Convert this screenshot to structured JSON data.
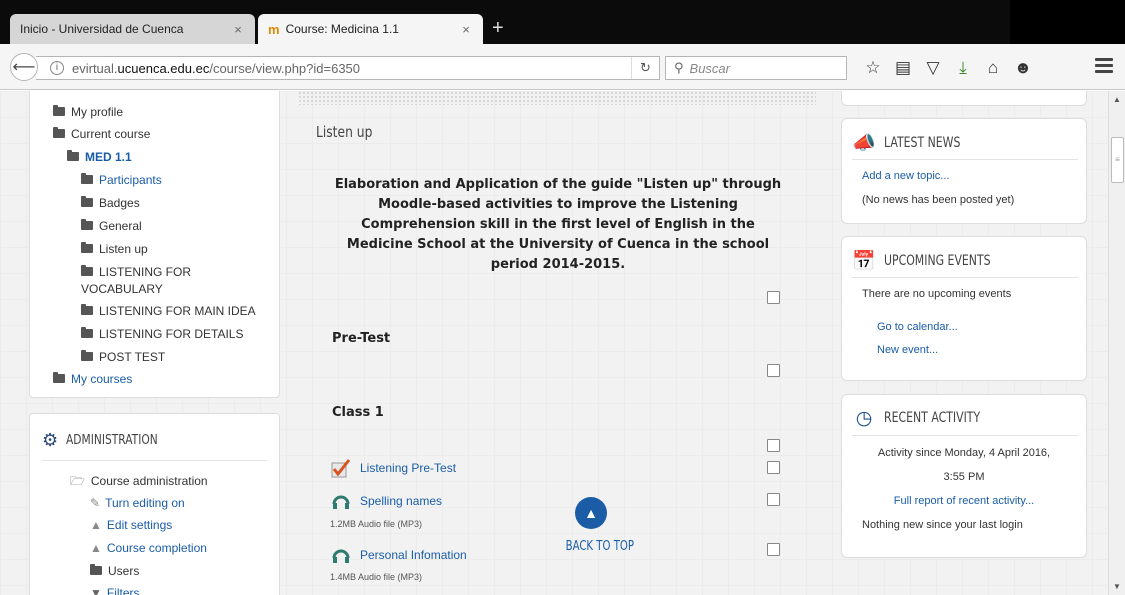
{
  "browser": {
    "tabs": [
      {
        "title": "Inicio - Universidad de Cuenca",
        "close": "×"
      },
      {
        "title": "Course: Medicina 1.1",
        "close": "×",
        "favicon": "m"
      }
    ],
    "new_tab": "+",
    "url_prefix": "evirtual.",
    "url_host": "ucuenca.edu.ec",
    "url_path": "/course/view.php?id=6350",
    "search_placeholder": "Buscar",
    "icons": [
      "star-icon",
      "reading-list-icon",
      "pocket-icon",
      "download-icon",
      "home-icon",
      "chat-icon",
      "menu-icon"
    ]
  },
  "navigation": {
    "items": [
      {
        "label": "My profile",
        "kind": "folder"
      },
      {
        "label": "Current course",
        "kind": "folder"
      },
      {
        "label": "MED 1.1",
        "kind": "folder-bold"
      },
      {
        "label": "Participants",
        "kind": "folder-link"
      },
      {
        "label": "Badges",
        "kind": "folder"
      },
      {
        "label": "General",
        "kind": "folder"
      },
      {
        "label": "Listen up",
        "kind": "folder"
      },
      {
        "label": "LISTENING FOR",
        "kind": "folder"
      },
      {
        "label": "VOCABULARY",
        "kind": "text"
      },
      {
        "label": "LISTENING FOR MAIN IDEA",
        "kind": "folder"
      },
      {
        "label": "LISTENING FOR DETAILS",
        "kind": "folder"
      },
      {
        "label": "POST TEST",
        "kind": "folder"
      },
      {
        "label": "My courses",
        "kind": "folder-link"
      }
    ]
  },
  "administration": {
    "title": "ADMINISTRATION",
    "items": [
      {
        "label": "Course administration"
      },
      {
        "label": "Turn editing on"
      },
      {
        "label": "Edit settings"
      },
      {
        "label": "Course completion"
      },
      {
        "label": "Users"
      },
      {
        "label": "Filters"
      }
    ]
  },
  "course": {
    "section_title": "Listen up",
    "summary": "Elaboration and Application of the guide \"Listen up\" through Moodle-based activities to improve the Listening Comprehension skill in the first level of English in the Medicine School at the University of Cuenca in the school period 2014-2015.",
    "pretest_heading": "Pre-Test",
    "class1_heading": "Class 1",
    "activities": [
      {
        "label": "Listening Pre-Test",
        "meta": ""
      },
      {
        "label": "Spelling names",
        "meta": "1.2MB Audio file (MP3)"
      },
      {
        "label": "Personal Infomation",
        "meta": "1.4MB Audio file (MP3)"
      }
    ],
    "back_to_top": "BACK TO TOP"
  },
  "latest_news": {
    "title": "LATEST NEWS",
    "add_topic": "Add a new topic...",
    "empty": "(No news has been posted yet)"
  },
  "upcoming_events": {
    "title": "UPCOMING EVENTS",
    "empty": "There are no upcoming events",
    "go_calendar": "Go to calendar...",
    "new_event": "New event..."
  },
  "recent_activity": {
    "title": "RECENT ACTIVITY",
    "since_line1": "Activity since Monday, 4 April 2016,",
    "since_line2": "3:55 PM",
    "full_report": "Full report of recent activity...",
    "nothing_new": "Nothing new since your last login"
  }
}
